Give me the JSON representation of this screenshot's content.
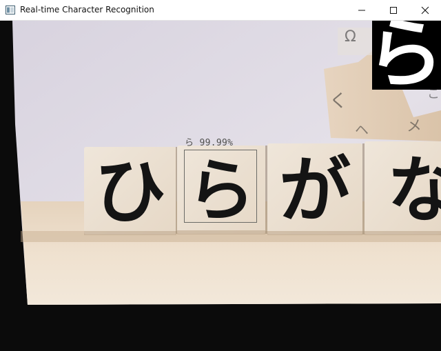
{
  "window": {
    "title": "Real-time Character Recognition"
  },
  "recognition": {
    "character": "ら",
    "confidence": "99.99%",
    "confidence_value": 99.99
  },
  "tiles": [
    "ひ",
    "ら",
    "が",
    "な"
  ],
  "preview": {
    "character": "ら"
  },
  "colors": {
    "titlebar": "#ffffff",
    "backdrop": "#dcd6e0",
    "tile": "#ecdcc8",
    "ink": "#141414",
    "box_border": "#6a6a66"
  }
}
